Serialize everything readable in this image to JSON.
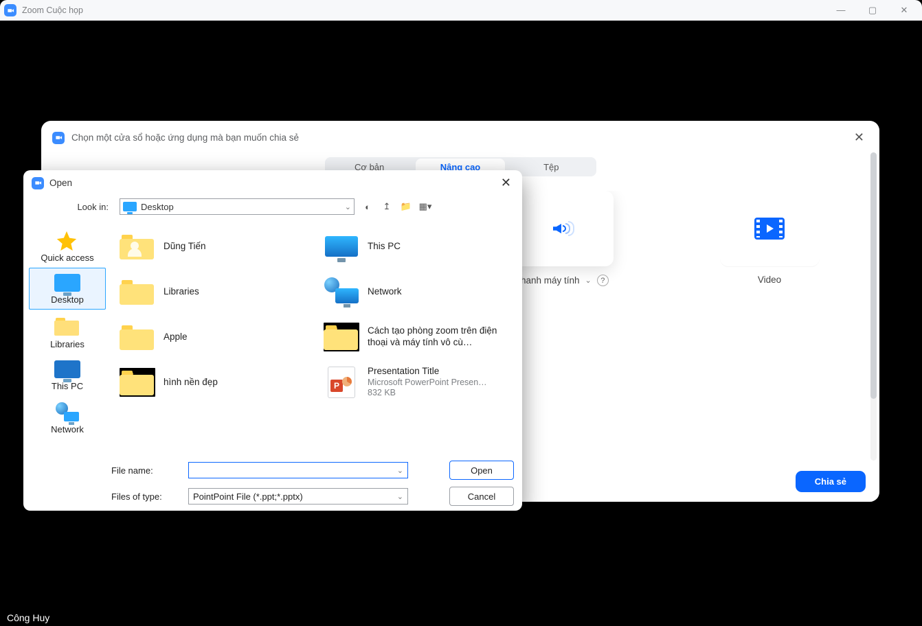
{
  "outer": {
    "title": "Zoom Cuộc họp"
  },
  "share_panel": {
    "title": "Chọn một cửa sổ hoặc ứng dụng mà bạn muốn chia sẻ",
    "tabs": {
      "basic": "Cơ bản",
      "advanced": "Nâng cao",
      "file": "Tệp"
    },
    "card_audio_label": "thanh máy tính",
    "card_video_label": "Video",
    "share_button": "Chia sẻ"
  },
  "file_dialog": {
    "title": "Open",
    "look_in_label": "Look in:",
    "look_in_value": "Desktop",
    "nav": {
      "quick": "Quick access",
      "desktop": "Desktop",
      "libraries": "Libraries",
      "thispc": "This PC",
      "network": "Network"
    },
    "items": {
      "user": "Dũng Tiến",
      "libraries": "Libraries",
      "apple": "Apple",
      "hinhnen": "hình nền đẹp",
      "thispc": "This PC",
      "network": "Network",
      "zoom_doc": "Cách tạo phòng zoom trên điện thoại và máy tính vô cù…",
      "ppt_title": "Presentation Title",
      "ppt_type": "Microsoft PowerPoint Presen…",
      "ppt_size": "832 KB"
    },
    "filename_label": "File name:",
    "filename_value": "",
    "filetype_label": "Files of type:",
    "filetype_value": "PointPoint File (*.ppt;*.pptx)",
    "open_btn": "Open",
    "cancel_btn": "Cancel"
  },
  "overlay_name": "Công Huy"
}
